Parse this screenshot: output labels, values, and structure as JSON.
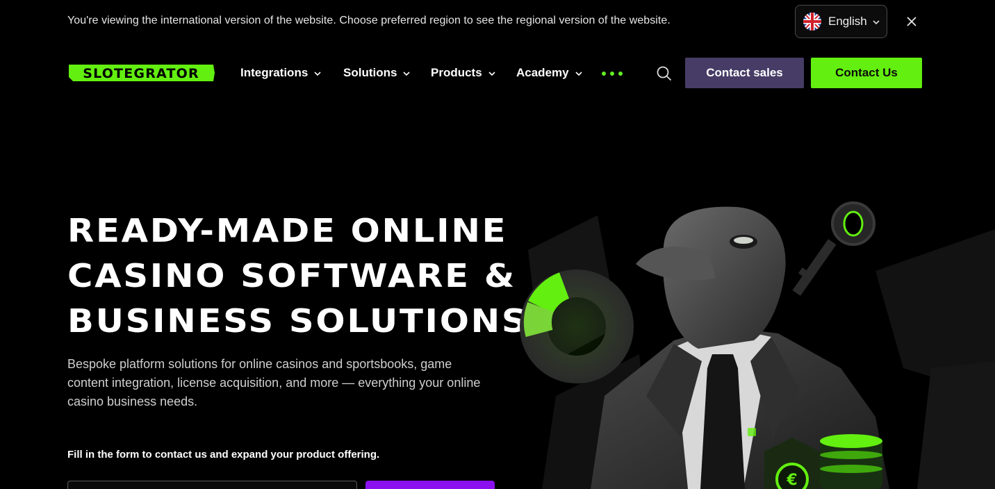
{
  "banner": {
    "message": "You're viewing the international version of the website. Choose preferred region to see the regional version of the website.",
    "language": "English",
    "flag_icon": "uk-flag-icon",
    "close_icon": "close-icon"
  },
  "nav": {
    "brand": "SLOTEGRATOR",
    "items": [
      {
        "label": "Integrations"
      },
      {
        "label": "Solutions"
      },
      {
        "label": "Products"
      },
      {
        "label": "Academy"
      }
    ],
    "more_icon": "more-dots-icon",
    "search_icon": "search-icon",
    "contact_sales": "Contact sales",
    "contact_us": "Contact Us"
  },
  "hero": {
    "title_lines": [
      "READY-MADE ONLINE",
      "CASINO SOFTWARE &",
      "BUSINESS SOLUTIONS"
    ],
    "description": "Bespoke platform solutions for online casinos and sportsbooks, game content integration, license acquisition, and more — everything your online casino business needs.",
    "form_hint": "Fill in the form to contact us and expand your product offering."
  },
  "colors": {
    "accent_green": "#63ef10",
    "sales_purple": "#463c66",
    "submit_purple": "#8a10f0",
    "background": "#000000"
  }
}
